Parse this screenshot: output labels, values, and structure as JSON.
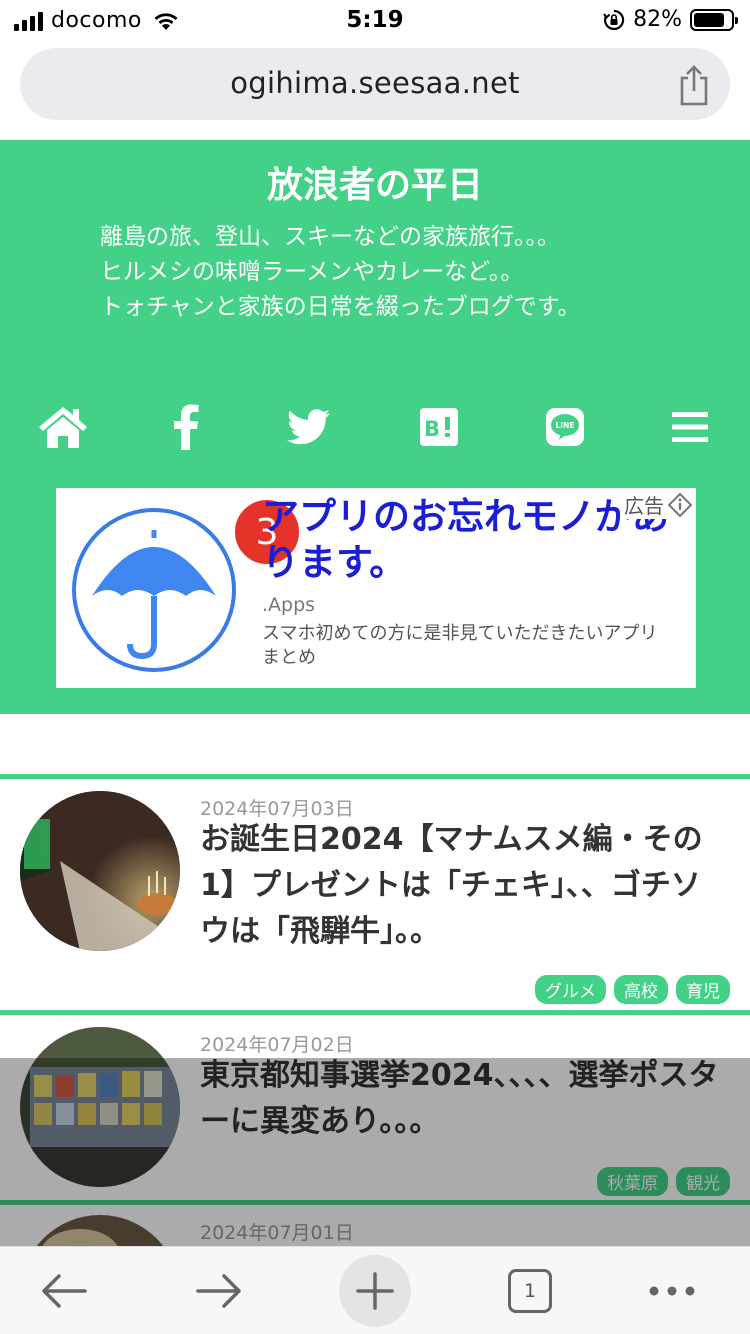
{
  "status_bar": {
    "carrier": "docomo",
    "time": "5:19",
    "battery_percent": "82%",
    "battery_level": 0.82,
    "icons": [
      "signal-icon",
      "wifi-icon",
      "rotation-lock-icon",
      "battery-icon"
    ]
  },
  "browser": {
    "url": "ogihima.seesaa.net",
    "share_icon": "share-icon"
  },
  "header": {
    "title": "放浪者の平日",
    "description_lines": [
      "離島の旅、登山、スキーなどの家族旅行。。。",
      "ヒルメシの味噌ラーメンやカレーなど。。",
      "トォチャンと家族の日常を綴ったブログです。"
    ],
    "icons": [
      "home-icon",
      "facebook-icon",
      "twitter-icon",
      "hatena-bookmark-icon",
      "line-icon",
      "menu-icon"
    ],
    "bg_color": "#42d186"
  },
  "ad": {
    "badge": "3",
    "headline": "アプリのお忘れモノがあります。",
    "label": "広告",
    "source": ".Apps",
    "body": "スマホ初めての方に是非見ていただきたいアプリまとめ",
    "headline_color": "#1a1ed6"
  },
  "posts": [
    {
      "date": "2024年07月03日",
      "title": "お誕生日2024【マナムスメ編・その1】プレゼントは「チェキ」、、ゴチソウは「飛騨牛」。。",
      "tags": [
        "グルメ",
        "高校",
        "育児"
      ]
    },
    {
      "date": "2024年07月02日",
      "title": "東京都知事選挙2024、、、、選挙ポスターに異変あり。。。",
      "tags": [
        "秋葉原",
        "観光"
      ]
    },
    {
      "date": "2024年07月01日",
      "title": "",
      "tags": []
    }
  ],
  "toolbar": {
    "tab_count": "1",
    "icons": [
      "back-arrow-icon",
      "forward-arrow-icon",
      "plus-icon",
      "tabs-icon",
      "more-icon"
    ]
  }
}
